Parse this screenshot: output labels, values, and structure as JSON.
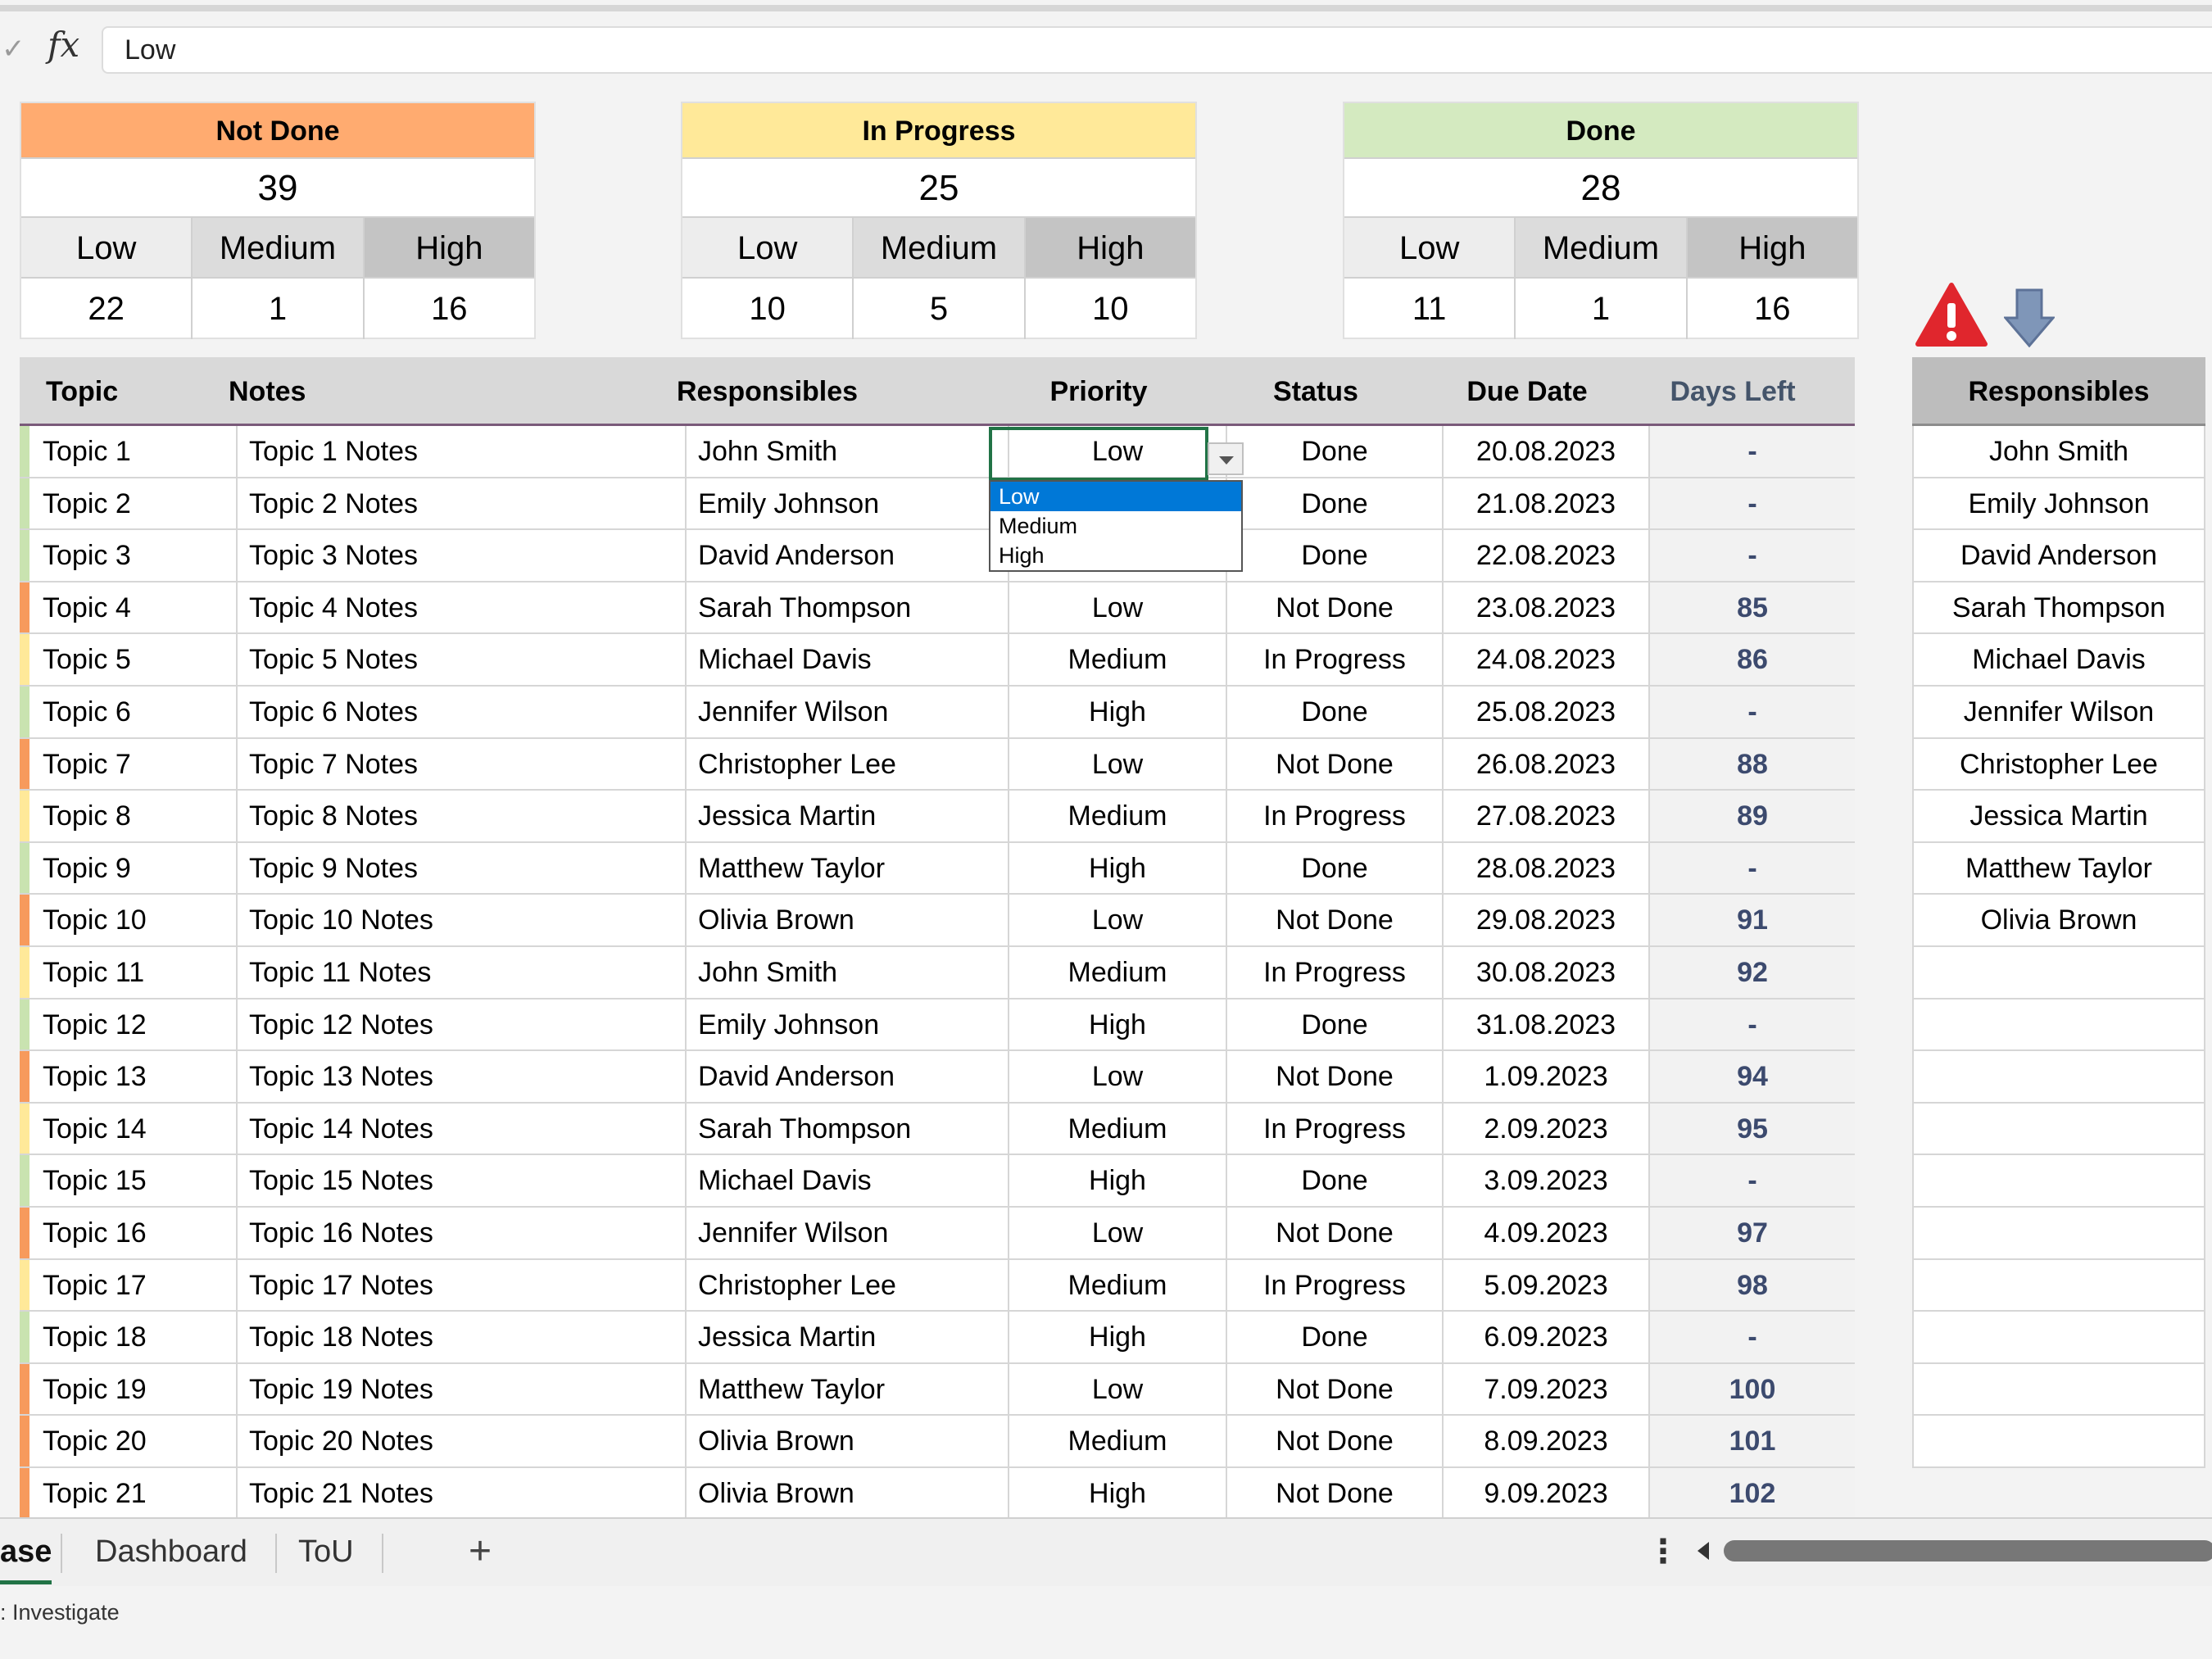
{
  "formula_bar": {
    "value": "Low"
  },
  "summaries": [
    {
      "title": "Not Done",
      "color": "#ffab70",
      "total": "39",
      "labels": [
        "Low",
        "Medium",
        "High"
      ],
      "values": [
        "22",
        "1",
        "16"
      ]
    },
    {
      "title": "In Progress",
      "color": "#ffe999",
      "total": "25",
      "labels": [
        "Low",
        "Medium",
        "High"
      ],
      "values": [
        "10",
        "5",
        "10"
      ]
    },
    {
      "title": "Done",
      "color": "#d4eac0",
      "total": "28",
      "labels": [
        "Low",
        "Medium",
        "High"
      ],
      "values": [
        "11",
        "1",
        "16"
      ]
    }
  ],
  "table": {
    "headers": {
      "topic": "Topic",
      "notes": "Notes",
      "responsibles": "Responsibles",
      "priority": "Priority",
      "status": "Status",
      "due": "Due Date",
      "days": "Days Left"
    },
    "rows": [
      {
        "topic": "Topic 1",
        "notes": "Topic 1 Notes",
        "resp": "John Smith",
        "priority": "Low",
        "status": "Done",
        "due": "20.08.2023",
        "days": "-"
      },
      {
        "topic": "Topic 2",
        "notes": "Topic 2 Notes",
        "resp": "Emily Johnson",
        "priority": "",
        "status": "Done",
        "due": "21.08.2023",
        "days": "-"
      },
      {
        "topic": "Topic 3",
        "notes": "Topic 3 Notes",
        "resp": "David Anderson",
        "priority": "",
        "status": "Done",
        "due": "22.08.2023",
        "days": "-"
      },
      {
        "topic": "Topic 4",
        "notes": "Topic 4 Notes",
        "resp": "Sarah Thompson",
        "priority": "Low",
        "status": "Not Done",
        "due": "23.08.2023",
        "days": "85"
      },
      {
        "topic": "Topic 5",
        "notes": "Topic 5 Notes",
        "resp": "Michael Davis",
        "priority": "Medium",
        "status": "In Progress",
        "due": "24.08.2023",
        "days": "86"
      },
      {
        "topic": "Topic 6",
        "notes": "Topic 6 Notes",
        "resp": "Jennifer Wilson",
        "priority": "High",
        "status": "Done",
        "due": "25.08.2023",
        "days": "-"
      },
      {
        "topic": "Topic 7",
        "notes": "Topic 7 Notes",
        "resp": "Christopher Lee",
        "priority": "Low",
        "status": "Not Done",
        "due": "26.08.2023",
        "days": "88"
      },
      {
        "topic": "Topic 8",
        "notes": "Topic 8 Notes",
        "resp": "Jessica Martin",
        "priority": "Medium",
        "status": "In Progress",
        "due": "27.08.2023",
        "days": "89"
      },
      {
        "topic": "Topic 9",
        "notes": "Topic 9 Notes",
        "resp": "Matthew Taylor",
        "priority": "High",
        "status": "Done",
        "due": "28.08.2023",
        "days": "-"
      },
      {
        "topic": "Topic 10",
        "notes": "Topic 10 Notes",
        "resp": "Olivia Brown",
        "priority": "Low",
        "status": "Not Done",
        "due": "29.08.2023",
        "days": "91"
      },
      {
        "topic": "Topic 11",
        "notes": "Topic 11 Notes",
        "resp": "John Smith",
        "priority": "Medium",
        "status": "In Progress",
        "due": "30.08.2023",
        "days": "92"
      },
      {
        "topic": "Topic 12",
        "notes": "Topic 12 Notes",
        "resp": "Emily Johnson",
        "priority": "High",
        "status": "Done",
        "due": "31.08.2023",
        "days": "-"
      },
      {
        "topic": "Topic 13",
        "notes": "Topic 13 Notes",
        "resp": "David Anderson",
        "priority": "Low",
        "status": "Not Done",
        "due": "1.09.2023",
        "days": "94"
      },
      {
        "topic": "Topic 14",
        "notes": "Topic 14 Notes",
        "resp": "Sarah Thompson",
        "priority": "Medium",
        "status": "In Progress",
        "due": "2.09.2023",
        "days": "95"
      },
      {
        "topic": "Topic 15",
        "notes": "Topic 15 Notes",
        "resp": "Michael Davis",
        "priority": "High",
        "status": "Done",
        "due": "3.09.2023",
        "days": "-"
      },
      {
        "topic": "Topic 16",
        "notes": "Topic 16 Notes",
        "resp": "Jennifer Wilson",
        "priority": "Low",
        "status": "Not Done",
        "due": "4.09.2023",
        "days": "97"
      },
      {
        "topic": "Topic 17",
        "notes": "Topic 17 Notes",
        "resp": "Christopher Lee",
        "priority": "Medium",
        "status": "In Progress",
        "due": "5.09.2023",
        "days": "98"
      },
      {
        "topic": "Topic 18",
        "notes": "Topic 18 Notes",
        "resp": "Jessica Martin",
        "priority": "High",
        "status": "Done",
        "due": "6.09.2023",
        "days": "-"
      },
      {
        "topic": "Topic 19",
        "notes": "Topic 19 Notes",
        "resp": "Matthew Taylor",
        "priority": "Low",
        "status": "Not Done",
        "due": "7.09.2023",
        "days": "100"
      },
      {
        "topic": "Topic 20",
        "notes": "Topic 20 Notes",
        "resp": "Olivia Brown",
        "priority": "Medium",
        "status": "Not Done",
        "due": "8.09.2023",
        "days": "101"
      },
      {
        "topic": "Topic 21",
        "notes": "Topic 21 Notes",
        "resp": "Olivia Brown",
        "priority": "High",
        "status": "Not Done",
        "due": "9.09.2023",
        "days": "102"
      }
    ]
  },
  "status_colors": {
    "Done": "#c9e3b0",
    "In Progress": "#ffe999",
    "Not Done": "#f79a5c"
  },
  "dropdown": {
    "options": [
      "Low",
      "Medium",
      "High"
    ],
    "highlighted": "Low"
  },
  "responsibles_panel": {
    "title": "Responsibles",
    "items": [
      "John Smith",
      "Emily Johnson",
      "David Anderson",
      "Sarah Thompson",
      "Michael Davis",
      "Jennifer Wilson",
      "Christopher Lee",
      "Jessica Martin",
      "Matthew Taylor",
      "Olivia Brown"
    ]
  },
  "icons": {
    "warning": "warning-triangle-icon",
    "arrow": "arrow-down-icon",
    "warning_color": "#e0262d",
    "arrow_color": "#7f96b8"
  },
  "sheet_tabs": {
    "active": "ase",
    "tabs": [
      "Dashboard",
      "ToU"
    ],
    "add": "+"
  },
  "status_bar": {
    "text": ": Investigate"
  }
}
